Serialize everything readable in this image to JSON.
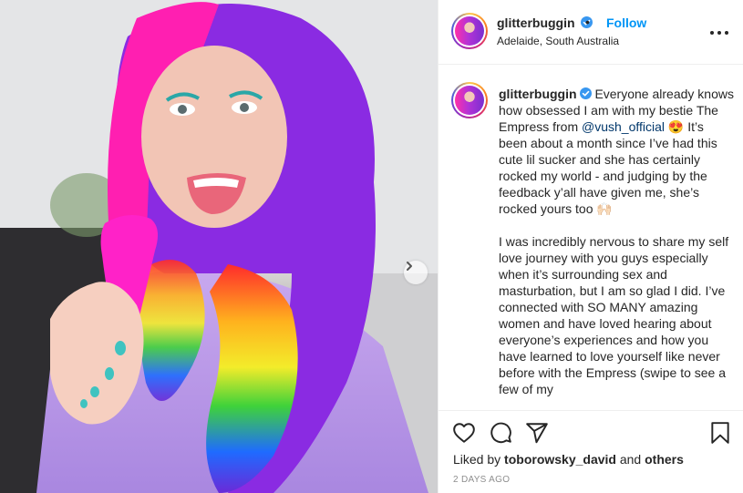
{
  "header": {
    "username": "glitterbuggin",
    "separator": "•",
    "follow_label": "Follow",
    "location": "Adelaide, South Australia"
  },
  "caption": {
    "username": "glitterbuggin",
    "part1": "Everyone already knows how obsessed I am with my bestie The Empress from ",
    "mention": "@vush_official",
    "emoji1": "😍",
    "part2": " It’s been about a month since I’ve had this cute lil sucker and she has certainly rocked my world - and judging by the feedback y’all have given me, she’s rocked yours too ",
    "emoji2": "🙌🏻",
    "paragraph2": "I was incredibly nervous to share my self love journey with you guys especially when it’s surrounding sex and masturbation, but I am so glad I did. I’ve connected with SO MANY amazing women and have loved hearing about everyone’s experiences and how you have learned to love yourself like never before with the Empress (swipe to see a few of my"
  },
  "likes": {
    "prefix": "Liked by ",
    "user": "toborowsky_david",
    "middle": " and ",
    "others": "others"
  },
  "time_ago": "2 DAYS AGO",
  "icons": {
    "verified": "verified-badge-icon",
    "more": "more-options-icon",
    "like": "heart-icon",
    "comment": "comment-icon",
    "share": "share-icon",
    "save": "bookmark-icon",
    "next": "chevron-right-icon"
  },
  "colors": {
    "accent": "#0095f6",
    "mention": "#00376b",
    "text": "#262626",
    "muted": "#8e8e8e"
  }
}
